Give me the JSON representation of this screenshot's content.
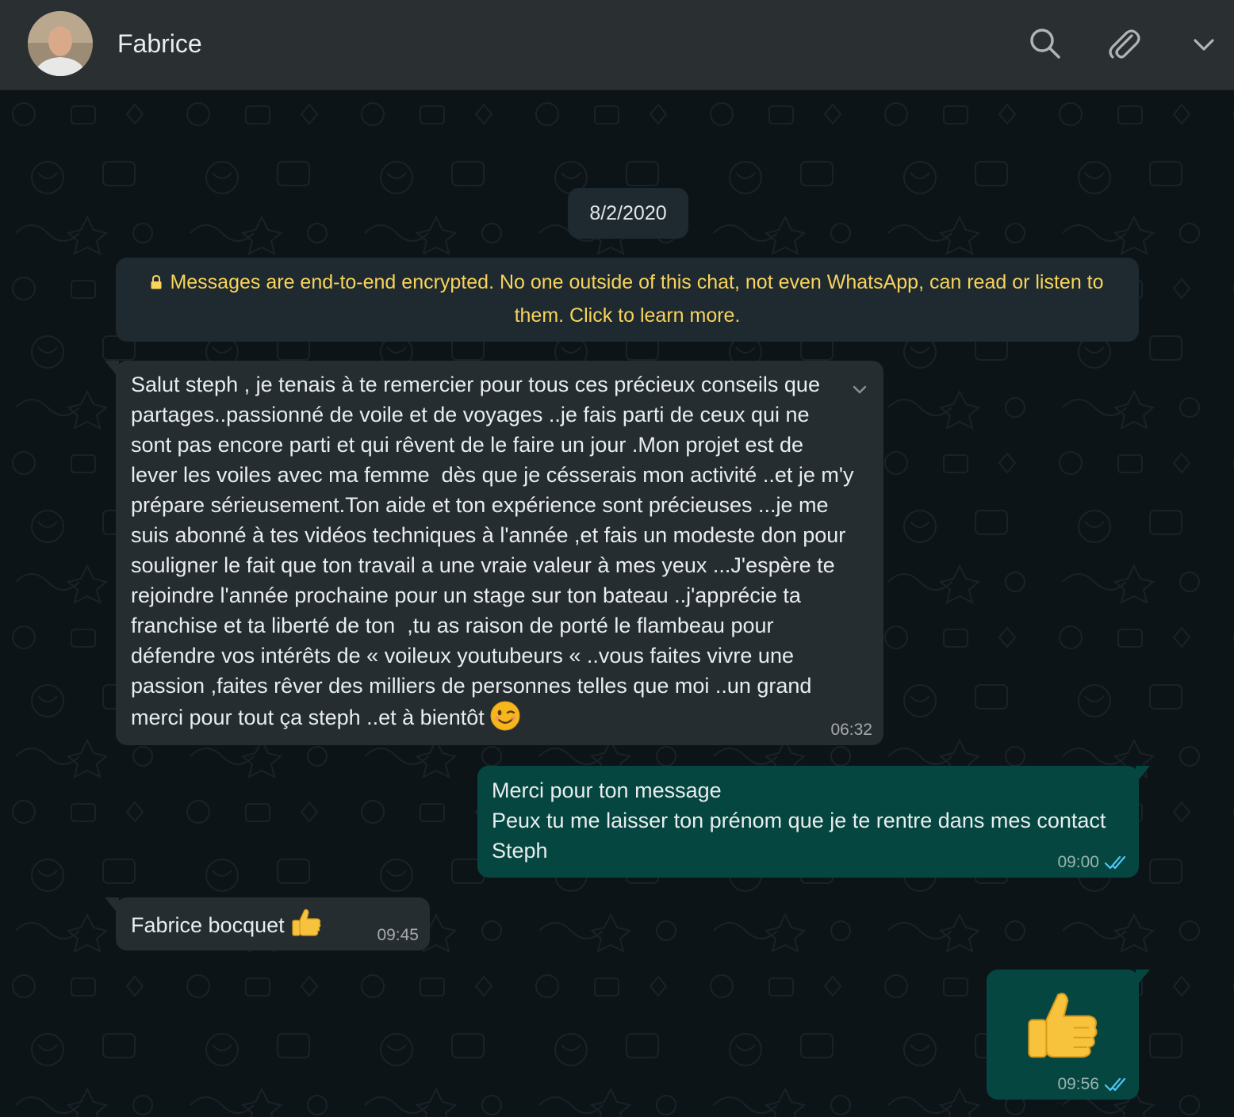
{
  "header": {
    "contact_name": "Fabrice",
    "icons": [
      "search-icon",
      "attach-icon",
      "menu-chevron-icon"
    ]
  },
  "chat": {
    "date_label": "8/2/2020",
    "encryption_notice": "Messages are end-to-end encrypted. No one outside of this chat, not even WhatsApp, can read or listen to them. Click to learn more.",
    "messages": [
      {
        "direction": "incoming",
        "text": "Salut steph , je tenais à te remercier pour tous ces précieux conseils que\npartages..passionné de voile et de voyages ..je fais parti de ceux qui ne\nsont pas encore parti et qui rêvent de le faire un jour .Mon projet est de\nlever les voiles avec ma femme  dès que je césserais mon activité ..et je m'y\nprépare sérieusement.Ton aide et ton expérience sont précieuses ...je me\nsuis abonné à tes vidéos techniques à l'année ,et fais un modeste don pour\nsouligner le fait que ton travail a une vraie valeur à mes yeux ...J'espère te\nrejoindre l'année prochaine pour un stage sur ton bateau ..j'apprécie ta\nfranchise et ta liberté de ton  ,tu as raison de porté le flambeau pour\ndéfendre vos intérêts de « voileux youtubeurs « ..vous faites vivre une\npassion ,faites rêver des milliers de personnes telles que moi ..un grand\nmerci pour tout ça steph ..et à bientôt",
        "emoji": "winking-face",
        "time": "06:32"
      },
      {
        "direction": "outgoing",
        "text": "Merci pour ton message\nPeux tu me laisser ton prénom que je te rentre dans mes contact\nSteph",
        "time": "09:00",
        "status": "read"
      },
      {
        "direction": "incoming",
        "text": "Fabrice bocquet",
        "emoji": "thumbs-up",
        "time": "09:45"
      },
      {
        "direction": "outgoing",
        "text": "",
        "emoji": "thumbs-up",
        "time": "09:56",
        "status": "read"
      }
    ]
  },
  "colors": {
    "header_bg": "#2a2f32",
    "chat_bg": "#0d1418",
    "incoming_bubble": "#262d31",
    "outgoing_bubble": "#054740",
    "notice_text": "#f9d35a",
    "read_check": "#4fc3f7"
  }
}
